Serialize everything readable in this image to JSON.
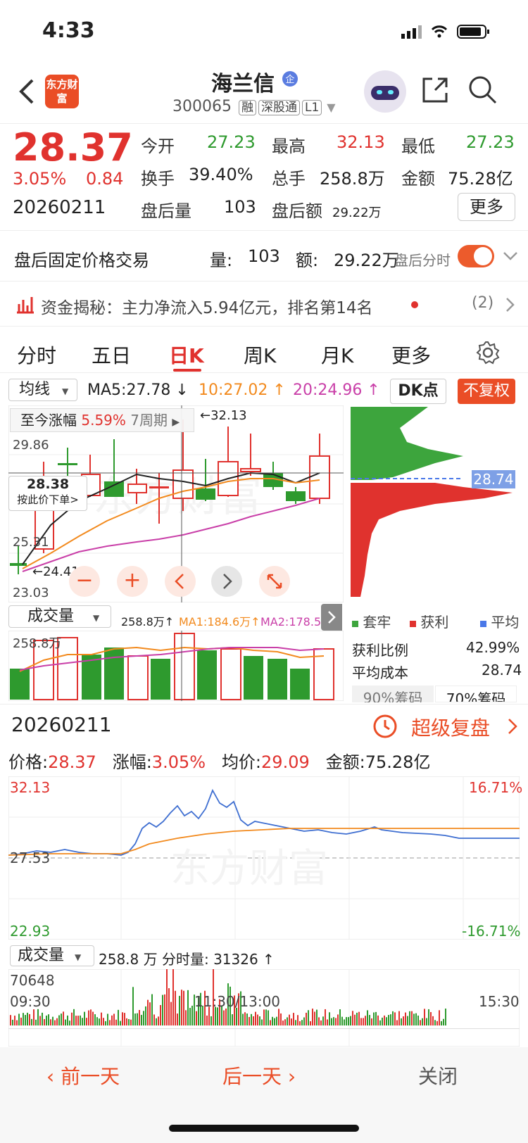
{
  "status_bar": {
    "time": "4:33"
  },
  "header": {
    "logo_text": "东方财富",
    "stock_name": "海兰信",
    "stock_code": "300065",
    "tags": [
      "融",
      "深股通",
      "L1"
    ]
  },
  "quote": {
    "price": "28.37",
    "change_pct": "3.05%",
    "change": "0.84",
    "date": "20260211",
    "open_label": "今开",
    "open": "27.23",
    "high_label": "最高",
    "high": "32.13",
    "low_label": "最低",
    "low": "27.23",
    "turnover_label": "换手",
    "turnover": "39.40%",
    "volume_label": "总手",
    "volume": "258.8万",
    "amount_label": "金额",
    "amount": "75.28亿",
    "after_vol_label": "盘后量",
    "after_vol": "103",
    "after_amt_label": "盘后额",
    "after_amt": "29.22万",
    "more_label": "更多"
  },
  "after_hours": {
    "title": "盘后固定价格交易",
    "vol_label": "量:",
    "vol": "103",
    "amt_label": "额:",
    "amt": "29.22万",
    "toggle_label": "盘后分时"
  },
  "fund": {
    "text": "资金揭秘：主力净流入5.94亿元，排名第14名",
    "count": "(2)"
  },
  "tabs": [
    "分时",
    "五日",
    "日K",
    "周K",
    "月K",
    "更多"
  ],
  "kline": {
    "ma_select": "均线",
    "ma5": "MA5:27.78 ↓",
    "ma10": "10:27.02 ↑",
    "ma20": "20:24.96 ↑",
    "dk_label": "DK点",
    "fuquan_label": "不复权",
    "range_label": "至今涨幅",
    "range_value": "5.59%",
    "range_period": "7周期",
    "high_mark": "←32.13",
    "low_mark": "←24.41",
    "y_top": "29.86",
    "y_mid": "25.31",
    "y_bot": "23.03",
    "cross_price": "28.38",
    "cross_order": "按此价下单>",
    "chip_price": "28.74"
  },
  "volume": {
    "select": "成交量",
    "total": "258.8万↑",
    "ma1": "MA1:184.6万↑",
    "ma2": "MA2:178.5万↑",
    "y_top": "258.8万"
  },
  "chip": {
    "legend_trapped": "套牢",
    "legend_profit": "获利",
    "legend_avg": "平均",
    "profit_ratio_label": "获利比例",
    "profit_ratio": "42.99%",
    "avg_cost_label": "平均成本",
    "avg_cost": "28.74",
    "tab_90": "90%筹码",
    "tab_70": "70%筹码"
  },
  "replay": {
    "date": "20260211",
    "super_label": "超级复盘",
    "price_label": "价格:",
    "price": "28.37",
    "pct_label": "涨幅:",
    "pct": "3.05%",
    "avg_label": "均价:",
    "avg": "29.09",
    "amt_label": "金额:",
    "amt": "75.28亿",
    "y_top": "32.13",
    "y_mid": "27.53",
    "y_bot": "22.93",
    "pct_top": "16.71%",
    "pct_bot": "-16.71%",
    "vol_select": "成交量",
    "vol_text": "258.8 万  分时量: 31326 ↑",
    "vol_max": "70648",
    "t_start": "09:30",
    "t_mid": "11:30/13:00",
    "t_end": "15:30"
  },
  "bottom_nav": {
    "prev": "前一天",
    "next": "后一天",
    "close": "关闭"
  },
  "colors": {
    "up": "#e0322e",
    "down": "#2e9a2e",
    "ma10": "#f28a1e",
    "ma20": "#c93fa8"
  }
}
